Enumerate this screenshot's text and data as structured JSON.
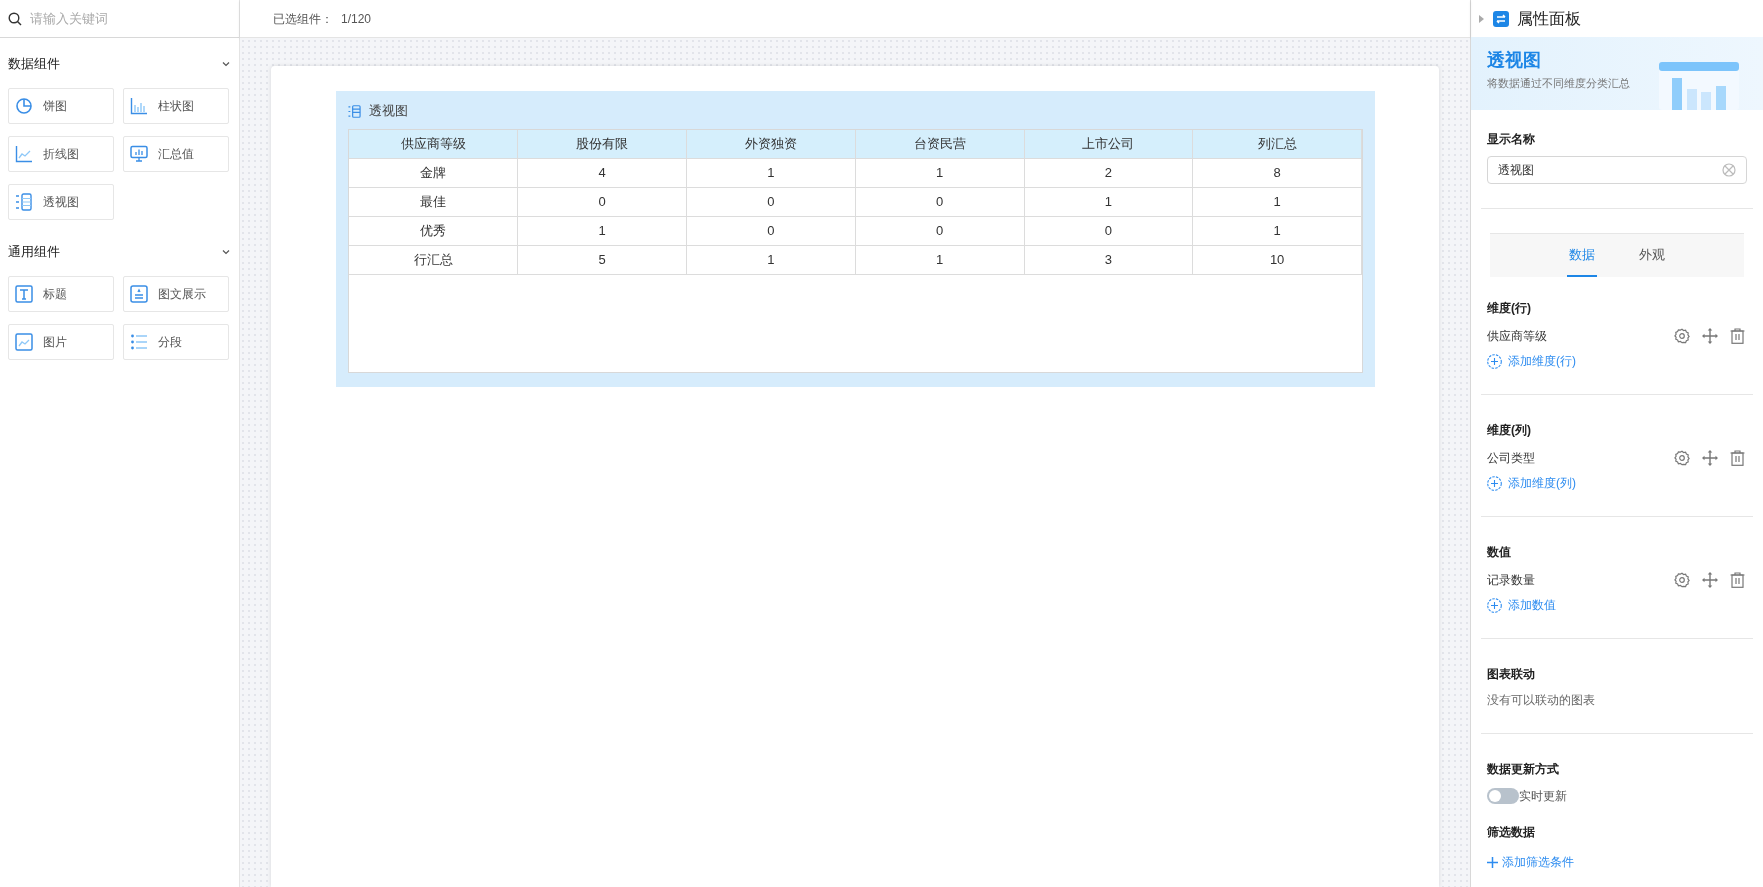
{
  "search": {
    "placeholder": "请输入关键词"
  },
  "component_groups": [
    {
      "title": "数据组件",
      "expanded": true,
      "items": [
        {
          "label": "饼图",
          "kind": "pie"
        },
        {
          "label": "柱状图",
          "kind": "bar"
        },
        {
          "label": "折线图",
          "kind": "line"
        },
        {
          "label": "汇总值",
          "kind": "monitor"
        },
        {
          "label": "透视图",
          "kind": "pivot"
        }
      ]
    },
    {
      "title": "通用组件",
      "expanded": true,
      "items": [
        {
          "label": "标题",
          "kind": "title"
        },
        {
          "label": "图文展示",
          "kind": "imagetext"
        },
        {
          "label": "图片",
          "kind": "image"
        },
        {
          "label": "分段",
          "kind": "list"
        }
      ]
    }
  ],
  "selection": {
    "label": "已选组件：",
    "value": "1/120"
  },
  "pivot": {
    "title": "透视图",
    "columns": [
      "供应商等级",
      "股份有限",
      "外资独资",
      "台资民营",
      "上市公司",
      "列汇总"
    ],
    "rows": [
      [
        "金牌",
        "4",
        "1",
        "1",
        "2",
        "8"
      ],
      [
        "最佳",
        "0",
        "0",
        "0",
        "1",
        "1"
      ],
      [
        "优秀",
        "1",
        "0",
        "0",
        "0",
        "1"
      ],
      [
        "行汇总",
        "5",
        "1",
        "1",
        "3",
        "10"
      ]
    ]
  },
  "panel": {
    "title": "属性面板",
    "banner": {
      "title": "透视图",
      "subtitle": "将数据通过不同维度分类汇总"
    },
    "display_name": {
      "label": "显示名称",
      "value": "透视图"
    },
    "tabs": [
      {
        "label": "数据",
        "selected": true
      },
      {
        "label": "外观",
        "selected": false
      }
    ],
    "fields": [
      {
        "title": "维度(行)",
        "items": [
          "供应商等级"
        ],
        "add_label": "添加维度(行)"
      },
      {
        "title": "维度(列)",
        "items": [
          "公司类型"
        ],
        "add_label": "添加维度(列)"
      },
      {
        "title": "数值",
        "items": [
          "记录数量"
        ],
        "add_label": "添加数值"
      }
    ],
    "chart_link": {
      "title": "图表联动",
      "text": "没有可以联动的图表"
    },
    "update": {
      "title": "数据更新方式",
      "toggle_label": "实时更新",
      "on": false
    },
    "filter": {
      "title": "筛选数据",
      "add_label": "添加筛选条件"
    }
  }
}
